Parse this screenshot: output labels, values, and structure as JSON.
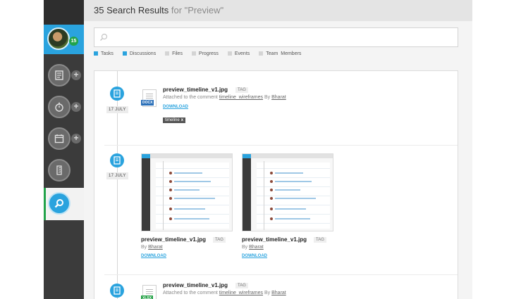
{
  "header": {
    "count_label": "35 Search Results",
    "query_label": "for \"Preview\""
  },
  "sidebar": {
    "avatar_badge": "15",
    "items": [
      {
        "name": "tasks",
        "icon": "document-icon"
      },
      {
        "name": "timer",
        "icon": "stopwatch-icon"
      },
      {
        "name": "calendar",
        "icon": "calendar-icon"
      },
      {
        "name": "files",
        "icon": "file-icon"
      },
      {
        "name": "search",
        "icon": "search-icon",
        "active": true
      }
    ],
    "colors": {
      "accent": "#2aa3de",
      "active_bar": "#22a34a"
    }
  },
  "search": {
    "placeholder": "",
    "value": ""
  },
  "filters": [
    {
      "label": "Tasks",
      "checked": true
    },
    {
      "label": "Discussions",
      "checked": true
    },
    {
      "label": "Files",
      "checked": false
    },
    {
      "label": "Progress",
      "checked": false
    },
    {
      "label": "Events",
      "checked": false
    },
    {
      "label": "Team  Members",
      "checked": false
    }
  ],
  "results": [
    {
      "date": "17 JULY",
      "file_type": "DOCX",
      "title": "preview_timeline_v1.jpg",
      "tag": "TAG",
      "meta_prefix": "Attached to the comment",
      "meta_link": "timeline_wireframes",
      "meta_by": "By",
      "author": "Bharat",
      "download": "DOWNLOAD",
      "chip": "timeline",
      "chip_close": "x"
    },
    {
      "date": "17 JULY",
      "images": [
        {
          "title": "preview_timeline_v1.jpg",
          "tag": "TAG",
          "by": "By",
          "author": "Bharat",
          "download": "DOWNLOAD"
        },
        {
          "title": "preview_timeline_v1.jpg",
          "tag": "TAG",
          "by": "By",
          "author": "Bharat",
          "download": "DOWNLOAD"
        }
      ]
    },
    {
      "file_type": "XLSX",
      "title": "preview_timeline_v1.jpg",
      "tag": "TAG",
      "meta_prefix": "Attached to the comment",
      "meta_link": "timeline_wireframes",
      "meta_by": "By",
      "author": "Bharat"
    }
  ]
}
